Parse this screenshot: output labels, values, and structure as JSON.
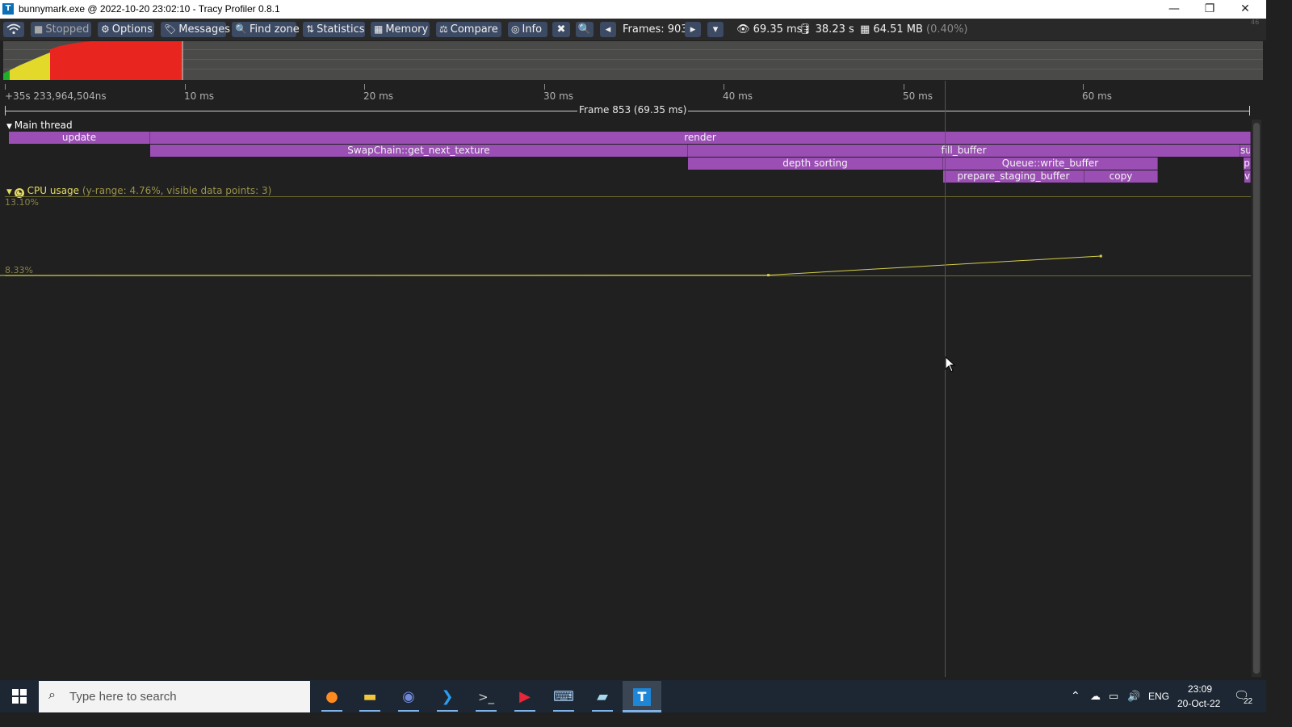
{
  "window": {
    "app_icon_letter": "T",
    "title": "bunnymark.exe @ 2022-10-20 23:02:10 - Tracy Profiler 0.8.1",
    "minimize": "—",
    "restore": "❐",
    "close": "✕"
  },
  "toolbar": {
    "connection_icon": "wifi-icon",
    "stopped": "Stopped",
    "options": "Options",
    "messages": "Messages",
    "find_zone": "Find zone",
    "statistics": "Statistics",
    "memory": "Memory",
    "compare": "Compare",
    "info": "Info",
    "frames": "Frames: 903",
    "view_time": "69.35 ms",
    "total_time": "38.23 s",
    "memory_usage": "64.51 MB",
    "memory_pct": "(0.40%)",
    "corner_num": "46"
  },
  "ruler": {
    "start": "+35s 233,964,504ns",
    "ticks": [
      "10 ms",
      "20 ms",
      "30 ms",
      "40 ms",
      "50 ms",
      "60 ms"
    ],
    "frame_label": "Frame 853 (69.35 ms)"
  },
  "timeline": {
    "thread_name": "Main thread",
    "zones": {
      "update": "update",
      "render": "render",
      "swapchain": "SwapChain::get_next_texture",
      "fill_buffer": "fill_buffer",
      "su": "su",
      "depth_sorting": "depth sorting",
      "queue_write": "Queue::write_buffer",
      "p": "p",
      "prepare_staging": "prepare_staging_buffer",
      "copy": "copy",
      "v": "v"
    }
  },
  "plot": {
    "name": "CPU usage",
    "info": "(y-range: 4.76%, visible data points: 3)",
    "max_label": "13.10%",
    "min_label": "8.33%",
    "points": [
      {
        "time_ms": -1.5,
        "value": 8.33
      },
      {
        "time_ms": 42.5,
        "value": 8.35
      },
      {
        "time_ms": 61.0,
        "value": 9.5
      }
    ]
  },
  "taskbar": {
    "search_placeholder": "Type here to search",
    "lang": "ENG",
    "time": "23:09",
    "date": "20-Oct-22",
    "notifications": "22"
  }
}
